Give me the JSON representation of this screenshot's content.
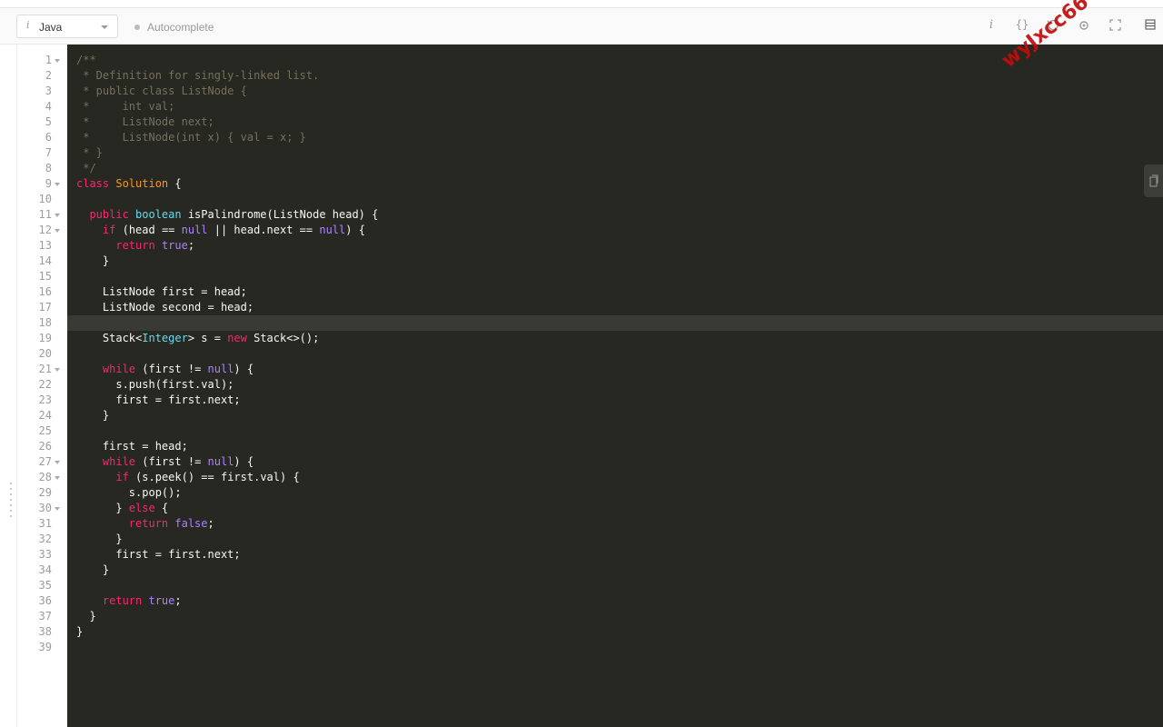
{
  "toolbar": {
    "language": "Java",
    "autocomplete_label": "Autocomplete",
    "icons": [
      "info-icon",
      "format-braces-icon",
      "reset-icon",
      "settings-icon",
      "fullscreen-icon",
      "layout-icon"
    ]
  },
  "watermark": "wyJxcc66",
  "editor": {
    "theme_colors": {
      "background": "#272822",
      "comment": "#75715e",
      "keyword": "#f92672",
      "constant": "#ae81ff",
      "type": "#66d9ef",
      "class_name": "#fd971f",
      "text": "#f8f8f2"
    },
    "active_line": 18,
    "fold_lines": [
      1,
      9,
      11,
      12,
      21,
      27,
      28,
      30
    ],
    "line_numbers": [
      "1",
      "2",
      "3",
      "4",
      "5",
      "6",
      "7",
      "8",
      "9",
      "10",
      "11",
      "12",
      "13",
      "14",
      "15",
      "16",
      "17",
      "18",
      "19",
      "20",
      "21",
      "22",
      "23",
      "24",
      "25",
      "26",
      "27",
      "28",
      "29",
      "30",
      "31",
      "32",
      "33",
      "34",
      "35",
      "36",
      "37",
      "38",
      "39"
    ],
    "lines": [
      [
        [
          "c",
          "/**"
        ]
      ],
      [
        [
          "c",
          " * Definition for singly-linked list."
        ]
      ],
      [
        [
          "c",
          " * public class ListNode {"
        ]
      ],
      [
        [
          "c",
          " *     int val;"
        ]
      ],
      [
        [
          "c",
          " *     ListNode next;"
        ]
      ],
      [
        [
          "c",
          " *     ListNode(int x) { val = x; }"
        ]
      ],
      [
        [
          "c",
          " * }"
        ]
      ],
      [
        [
          "c",
          " */"
        ]
      ],
      [
        [
          "k",
          "class "
        ],
        [
          "n",
          "Solution"
        ],
        [
          "p",
          " {"
        ]
      ],
      [
        [
          "p",
          ""
        ]
      ],
      [
        [
          "p",
          "  "
        ],
        [
          "k",
          "public "
        ],
        [
          "t",
          "boolean "
        ],
        [
          "p",
          "isPalindrome(ListNode head) {"
        ]
      ],
      [
        [
          "p",
          "    "
        ],
        [
          "k",
          "if "
        ],
        [
          "p",
          "(head == "
        ],
        [
          "v",
          "null"
        ],
        [
          "p",
          " || head.next == "
        ],
        [
          "v",
          "null"
        ],
        [
          "p",
          ") {"
        ]
      ],
      [
        [
          "p",
          "      "
        ],
        [
          "k",
          "return "
        ],
        [
          "v",
          "true"
        ],
        [
          "p",
          ";"
        ]
      ],
      [
        [
          "p",
          "    }"
        ]
      ],
      [
        [
          "p",
          ""
        ]
      ],
      [
        [
          "p",
          "    ListNode first = head;"
        ]
      ],
      [
        [
          "p",
          "    ListNode second = head;"
        ]
      ],
      [
        [
          "p",
          ""
        ]
      ],
      [
        [
          "p",
          "    Stack<"
        ],
        [
          "t",
          "Integer"
        ],
        [
          "p",
          "> s = "
        ],
        [
          "k",
          "new "
        ],
        [
          "p",
          "Stack<>();"
        ]
      ],
      [
        [
          "p",
          ""
        ]
      ],
      [
        [
          "p",
          "    "
        ],
        [
          "k",
          "while "
        ],
        [
          "p",
          "(first != "
        ],
        [
          "v",
          "null"
        ],
        [
          "p",
          ") {"
        ]
      ],
      [
        [
          "p",
          "      s.push(first.val);"
        ]
      ],
      [
        [
          "p",
          "      first = first.next;"
        ]
      ],
      [
        [
          "p",
          "    }"
        ]
      ],
      [
        [
          "p",
          ""
        ]
      ],
      [
        [
          "p",
          "    first = head;"
        ]
      ],
      [
        [
          "p",
          "    "
        ],
        [
          "k",
          "while "
        ],
        [
          "p",
          "(first != "
        ],
        [
          "v",
          "null"
        ],
        [
          "p",
          ") {"
        ]
      ],
      [
        [
          "p",
          "      "
        ],
        [
          "k",
          "if "
        ],
        [
          "p",
          "(s.peek() == first.val) {"
        ]
      ],
      [
        [
          "p",
          "        s.pop();"
        ]
      ],
      [
        [
          "p",
          "      } "
        ],
        [
          "k",
          "else "
        ],
        [
          "p",
          "{"
        ]
      ],
      [
        [
          "p",
          "        "
        ],
        [
          "k",
          "return "
        ],
        [
          "v",
          "false"
        ],
        [
          "p",
          ";"
        ]
      ],
      [
        [
          "p",
          "      }"
        ]
      ],
      [
        [
          "p",
          "      first = first.next;"
        ]
      ],
      [
        [
          "p",
          "    }"
        ]
      ],
      [
        [
          "p",
          ""
        ]
      ],
      [
        [
          "p",
          "    "
        ],
        [
          "k",
          "return "
        ],
        [
          "v",
          "true"
        ],
        [
          "p",
          ";"
        ]
      ],
      [
        [
          "p",
          "  }"
        ]
      ],
      [
        [
          "p",
          "}"
        ]
      ],
      [
        [
          "p",
          ""
        ]
      ]
    ]
  }
}
